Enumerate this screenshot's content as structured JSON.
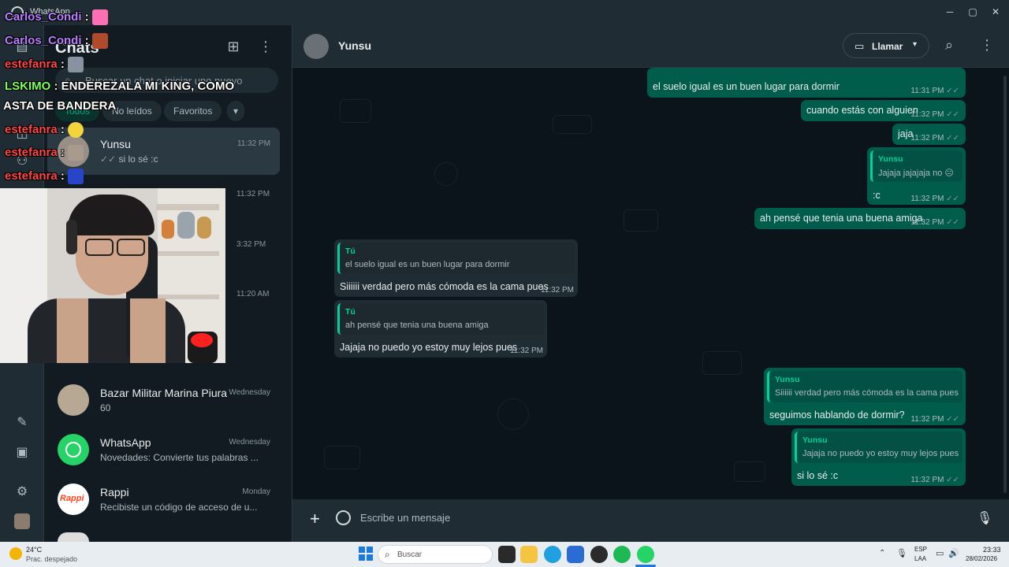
{
  "window": {
    "title": "WhatsApp",
    "minimize": "─",
    "maximize": "▢",
    "close": "✕"
  },
  "sidebar": {
    "title": "Chats",
    "search_placeholder": "Buscar un chat o iniciar uno nuevo",
    "filters": [
      "Todos",
      "No leídos",
      "Favoritos",
      "▾"
    ],
    "chats": [
      {
        "name": "Yunsu",
        "time": "11:32 PM",
        "preview": "si lo sé :c",
        "ticks": "✓✓"
      },
      {
        "name": "Bazar Militar Marina Piura",
        "time": "Wednesday",
        "preview": "60"
      },
      {
        "name": "WhatsApp",
        "time": "Wednesday",
        "preview": "Novedades: Convierte tus palabras ..."
      },
      {
        "name": "Rappi",
        "time": "Monday",
        "preview": "Recibiste un código de acceso de u...",
        "avatar_text": "Rappi"
      }
    ],
    "extra_times": [
      "11:32 PM",
      "3:32 PM",
      "11:20 AM"
    ]
  },
  "header": {
    "contact_name": "Yunsu",
    "call_label": "Llamar"
  },
  "messages": [
    {
      "dir": "out",
      "text": "el suelo igual es un buen lugar para dormir",
      "time": "11:31 PM"
    },
    {
      "dir": "out",
      "text": "cuando estás con alguien",
      "time": "11:32 PM"
    },
    {
      "dir": "out",
      "text": "jaja",
      "time": "11:32 PM"
    },
    {
      "dir": "out",
      "quote_name": "Yunsu",
      "quote_text": "Jajaja jajajaja no 😑",
      "text": ":c",
      "time": "11:32 PM"
    },
    {
      "dir": "out",
      "text": "ah pensé que tenia una buena amiga",
      "time": "11:32 PM"
    },
    {
      "dir": "in",
      "quote_name": "Tú",
      "quote_text": "el suelo igual es un buen lugar para dormir",
      "text": "Siiiiii verdad pero más cómoda es la cama pues",
      "time": "11:32 PM"
    },
    {
      "dir": "in",
      "quote_name": "Tú",
      "quote_text": "ah pensé que tenia una buena amiga",
      "text": "Jajaja no puedo yo estoy muy lejos pues",
      "time": "11:32 PM"
    },
    {
      "dir": "out",
      "quote_name": "Yunsu",
      "quote_text": "Siiiiii verdad pero más cómoda es la cama pues",
      "text": "seguimos hablando de dormir?",
      "time": "11:32 PM"
    },
    {
      "dir": "out",
      "quote_name": "Yunsu",
      "quote_text": "Jajaja no puedo yo estoy muy lejos pues",
      "text": "si lo sé :c",
      "time": "11:32 PM"
    }
  ],
  "ticks": "✓✓",
  "composer": {
    "placeholder": "Escribe un mensaje"
  },
  "taskbar": {
    "weather_temp": "24°C",
    "weather_desc": "Prac. despejado",
    "search_label": "Buscar",
    "lang_top": "ESP",
    "lang_bottom": "LAA",
    "clock_time": "23:33",
    "clock_date": "28/02/2026"
  },
  "stream_chat": [
    {
      "user": "Carlos_Condi",
      "sep": " :",
      "color": "purple"
    },
    {
      "user": "Carlos_Condi",
      "sep": " :",
      "color": "purple"
    },
    {
      "user": "estefanra",
      "sep": " :",
      "color": "red"
    },
    {
      "user": "LSKIMO",
      "sep": " : ENDEREZALA MI KING, COMO",
      "color": "green"
    },
    {
      "user": "",
      "sep": "ASTA DE BANDERA",
      "color": "white"
    },
    {
      "user": "estefanra",
      "sep": " :",
      "color": "red"
    },
    {
      "user": "estefanra",
      "sep": " :",
      "color": "red"
    },
    {
      "user": "estefanra",
      "sep": " :",
      "color": "red"
    }
  ],
  "colors": {
    "accent": "#00a884",
    "outgoing": "#005c4b",
    "incoming": "#202c33",
    "background": "#0b141a"
  },
  "icons": [
    "whatsapp-icon",
    "chats-icon",
    "status-icon",
    "communities-icon",
    "new-chat-icon",
    "menu-icon",
    "search-icon",
    "video-call-icon",
    "plus-icon",
    "sticker-icon",
    "mic-icon",
    "settings-icon"
  ]
}
